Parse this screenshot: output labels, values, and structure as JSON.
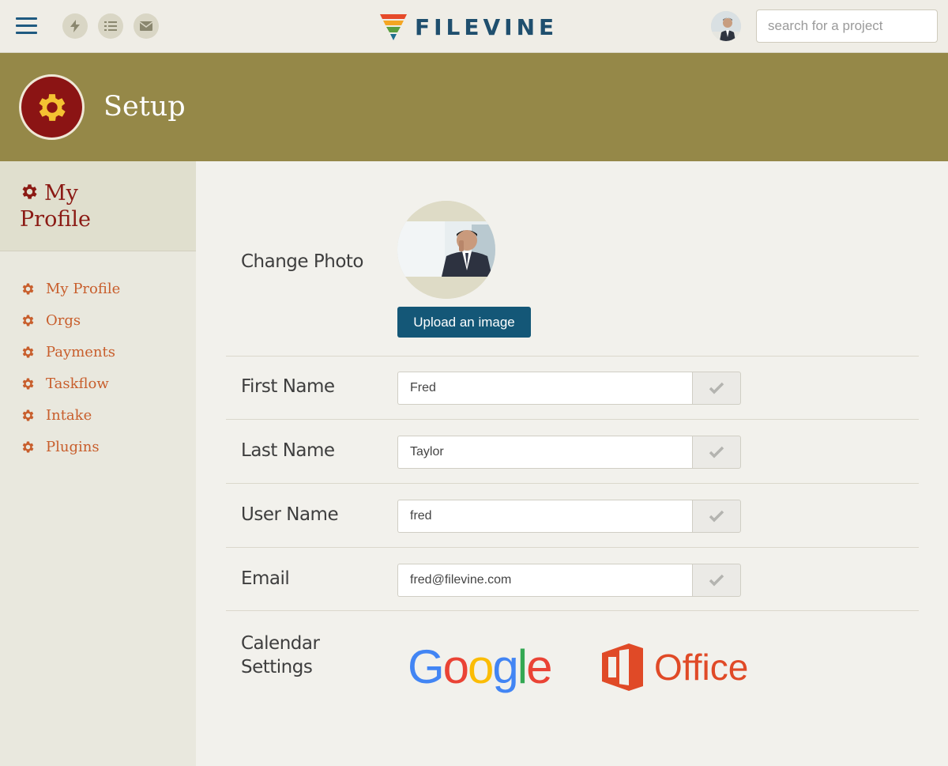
{
  "brand": {
    "name": "FILEVINE"
  },
  "search": {
    "placeholder": "search for a project"
  },
  "header": {
    "title": "Setup"
  },
  "sidebar": {
    "title_line1": "My",
    "title_line2": "Profile",
    "items": [
      {
        "label": "My Profile"
      },
      {
        "label": "Orgs"
      },
      {
        "label": "Payments"
      },
      {
        "label": "Taskflow"
      },
      {
        "label": "Intake"
      },
      {
        "label": "Plugins"
      }
    ]
  },
  "profile": {
    "photo_label": "Change Photo",
    "upload_label": "Upload an image",
    "fields": [
      {
        "label": "First Name",
        "value": "Fred"
      },
      {
        "label": "Last Name",
        "value": "Taylor"
      },
      {
        "label": "User Name",
        "value": "fred"
      },
      {
        "label": "Email",
        "value": "fred@filevine.com"
      }
    ],
    "calendar_label_line1": "Calendar",
    "calendar_label_line2": "Settings",
    "google_label": [
      "G",
      "o",
      "o",
      "g",
      "l",
      "e"
    ],
    "office_label": "Office"
  },
  "icons": {
    "menu": "hamburger-icon",
    "bolt": "lightning-icon",
    "list": "list-icon",
    "mail": "envelope-icon",
    "gear": "gear-icon",
    "check": "checkmark-icon"
  },
  "colors": {
    "accent": "#145777",
    "header": "#958848",
    "maroon": "#8b1414",
    "gold": "#f4c232",
    "link": "#c85e2c",
    "google_blue": "#4285f4",
    "google_red": "#ea4335",
    "google_yellow": "#fbbc05",
    "google_green": "#34a853",
    "office_red": "#e04a27"
  }
}
